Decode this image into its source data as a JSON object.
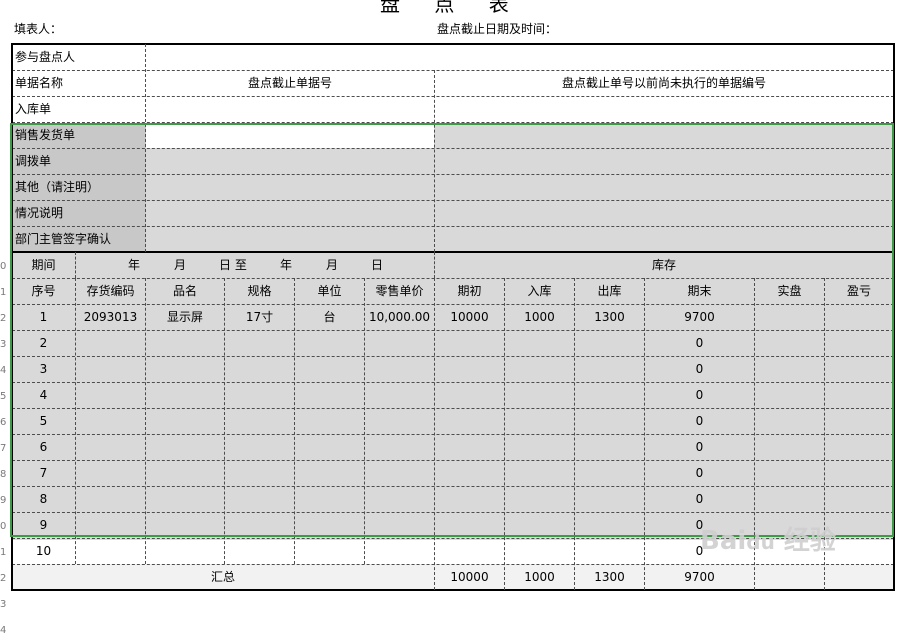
{
  "title": "盘 点 表",
  "filler_label": "填表人：",
  "deadline_label": "盘点截止日期及时间：",
  "info": {
    "participants": "参与盘点人",
    "doc_name": "单据名称",
    "cutoff_no": "盘点截止单据号",
    "unexecuted_no": "盘点截止单号以前尚未执行的单据编号",
    "rows": [
      "入库单",
      "销售发货单",
      "调拨单",
      "其他（请注明）",
      "情况说明",
      "部门主管签字确认"
    ]
  },
  "period": {
    "label": "期间",
    "date_range": [
      "年",
      "月",
      "日 至",
      "年",
      "月",
      "日"
    ],
    "inventory": "库存"
  },
  "columns": [
    "序号",
    "存货编码",
    "品名",
    "规格",
    "单位",
    "零售单价",
    "期初",
    "入库",
    "出库",
    "期末",
    "实盘",
    "盈亏"
  ],
  "rows": [
    {
      "no": "1",
      "code": "2093013",
      "name": "显示屏",
      "spec": "17寸",
      "unit": "台",
      "price": "10,000.00",
      "open": "10000",
      "in": "1000",
      "out": "1300",
      "end": "9700"
    },
    {
      "no": "2",
      "end": "0"
    },
    {
      "no": "3",
      "end": "0"
    },
    {
      "no": "4",
      "end": "0"
    },
    {
      "no": "5",
      "end": "0"
    },
    {
      "no": "6",
      "end": "0"
    },
    {
      "no": "7",
      "end": "0"
    },
    {
      "no": "8",
      "end": "0"
    },
    {
      "no": "9",
      "end": "0"
    },
    {
      "no": "10",
      "end": "0"
    }
  ],
  "total": {
    "label": "汇总",
    "open": "10000",
    "in": "1000",
    "out": "1300",
    "end": "9700"
  },
  "row_header_numbers": [
    "",
    "",
    "",
    "",
    "",
    "",
    "",
    "",
    "",
    "0",
    "1",
    "2",
    "3",
    "4",
    "5",
    "6",
    "7",
    "8",
    "9",
    "0",
    "1",
    "2",
    "3",
    "4"
  ],
  "watermark": "Baidu 经验",
  "colors": {
    "shade": "#d9d9d9",
    "selection": "#3f9a47"
  }
}
